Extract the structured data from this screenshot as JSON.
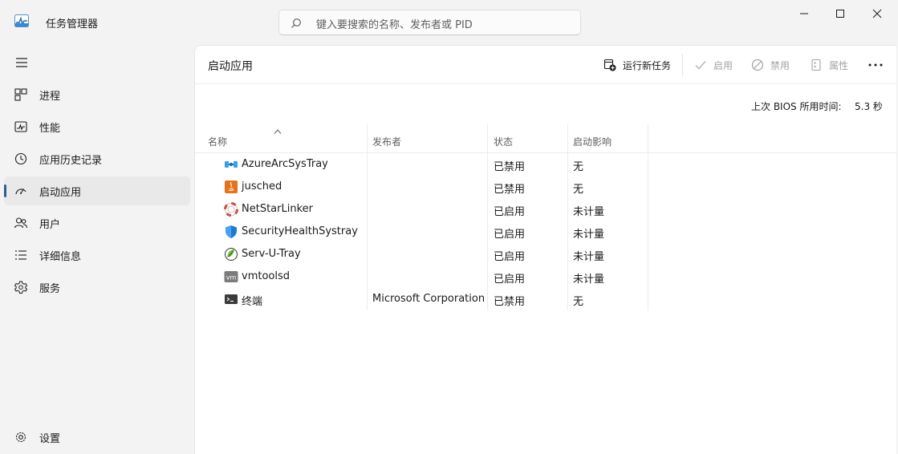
{
  "app": {
    "title": "任务管理器",
    "search_placeholder": "键入要搜索的名称、发布者或 PID"
  },
  "sidebar": {
    "items": [
      {
        "label": "进程",
        "icon": "processes-icon"
      },
      {
        "label": "性能",
        "icon": "performance-icon"
      },
      {
        "label": "应用历史记录",
        "icon": "app-history-icon"
      },
      {
        "label": "启动应用",
        "icon": "startup-apps-icon",
        "active": true
      },
      {
        "label": "用户",
        "icon": "users-icon"
      },
      {
        "label": "详细信息",
        "icon": "details-icon"
      },
      {
        "label": "服务",
        "icon": "services-icon"
      }
    ],
    "settings_label": "设置"
  },
  "page": {
    "title": "启动应用",
    "toolbar": {
      "run_new_task": "运行新任务",
      "enable": "启用",
      "disable": "禁用",
      "properties": "属性"
    },
    "bios_label": "上次 BIOS 所用时间:",
    "bios_value": "5.3 秒"
  },
  "table": {
    "columns": [
      "名称",
      "发布者",
      "状态",
      "启动影响"
    ],
    "rows": [
      {
        "name": "AzureArcSysTray",
        "publisher": "",
        "status": "已禁用",
        "impact": "无",
        "icon": "azure-arc-icon"
      },
      {
        "name": "jusched",
        "publisher": "",
        "status": "已禁用",
        "impact": "无",
        "icon": "java-icon"
      },
      {
        "name": "NetStarLinker",
        "publisher": "",
        "status": "已启用",
        "impact": "未计量",
        "icon": "lifebuoy-icon"
      },
      {
        "name": "SecurityHealthSystray",
        "publisher": "",
        "status": "已启用",
        "impact": "未计量",
        "icon": "shield-icon"
      },
      {
        "name": "Serv-U-Tray",
        "publisher": "",
        "status": "已启用",
        "impact": "未计量",
        "icon": "servu-icon"
      },
      {
        "name": "vmtoolsd",
        "publisher": "",
        "status": "已启用",
        "impact": "未计量",
        "icon": "vm-icon"
      },
      {
        "name": "终端",
        "publisher": "Microsoft Corporation",
        "status": "已禁用",
        "impact": "无",
        "icon": "terminal-icon"
      }
    ]
  },
  "colors": {
    "accent": "#2a5f90",
    "sidebar_bg": "#f3f3f3",
    "panel_bg": "#ffffff",
    "active_nav_bg": "#e9e9e9"
  }
}
